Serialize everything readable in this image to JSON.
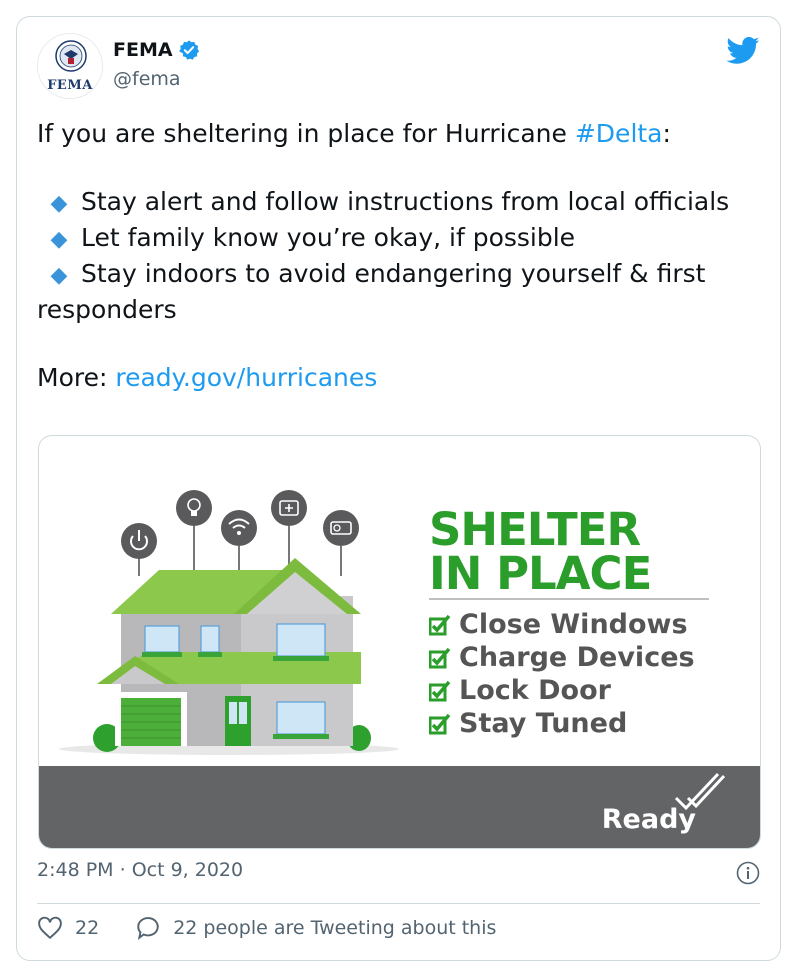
{
  "author": {
    "name": "FEMA",
    "handle": "@fema",
    "avatar_text": "FEMA",
    "verified": true
  },
  "tweet": {
    "intro_prefix": "If you are sheltering in place for Hurricane ",
    "hashtag": "#Delta",
    "intro_suffix": ":",
    "bullets": [
      {
        "icon": "◆",
        "text": "Stay alert and follow instructions from local officials"
      },
      {
        "icon": "◆",
        "text": "Let family know you’re okay, if possible"
      },
      {
        "icon": "◆",
        "text": "Stay indoors to avoid endangering yourself & first responders"
      }
    ],
    "more_label": "More: ",
    "link": "ready.gov/hurricanes"
  },
  "media": {
    "title_line1": "SHELTER",
    "title_line2": "IN PLACE",
    "checklist": [
      "Close Windows",
      "Charge Devices",
      "Lock Door",
      "Stay Tuned"
    ],
    "brand": "Ready",
    "device_icons": [
      "power-icon",
      "lightbulb-icon",
      "wifi-icon",
      "first-aid-icon",
      "radio-icon"
    ]
  },
  "meta": {
    "time": "2:48 PM",
    "separator": " · ",
    "date": "Oct 9, 2020"
  },
  "footer": {
    "likes": "22",
    "tweeting_text": "22 people are Tweeting about this"
  },
  "colors": {
    "link": "#1d9bf0",
    "bullet": "#3b94d9",
    "shelter_green": "#2a9d2a",
    "ready_band": "#636466"
  }
}
